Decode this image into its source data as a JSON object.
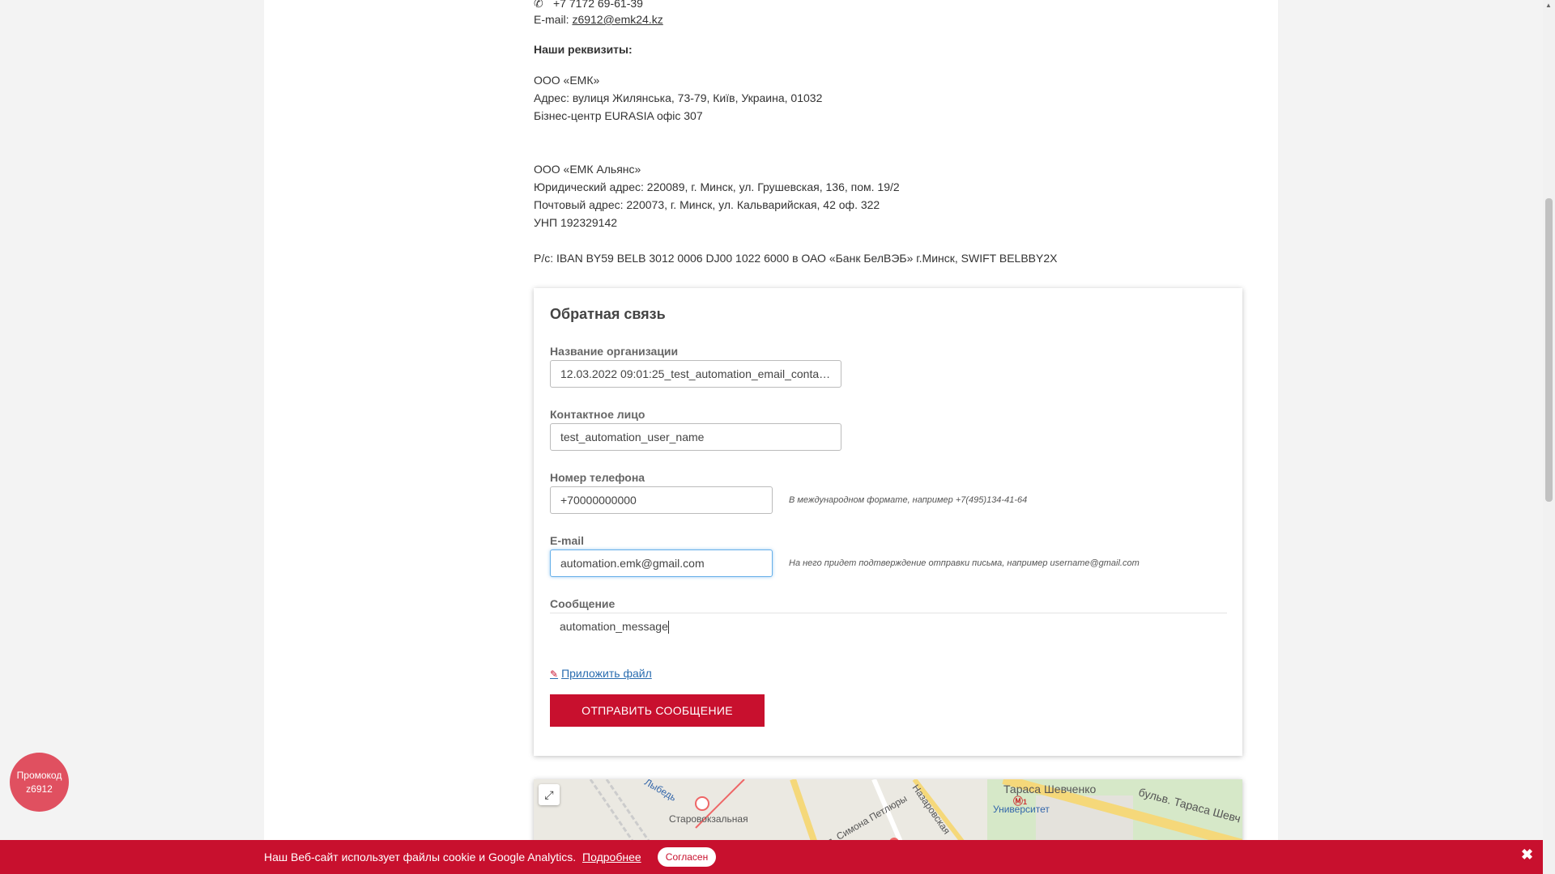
{
  "contacts": {
    "phone": "+7 7172 69-61-39",
    "email_label": "E-mail:",
    "email": "z6912@emk24.kz"
  },
  "requisites": {
    "heading": "Наши реквизиты:",
    "company1_name": "ООО «ЕМК»",
    "company1_address": "Адрес: вулиця Жилянська, 73-79, Київ, Украина, 01032",
    "company1_office": "Бізнес-центр EURASIA офіс 307",
    "company2_name": "ООО «ЕМК Альянс»",
    "company2_legal": "Юридический адрес: 220089, г. Минск, ул. Грушевская, 136, пом. 19/2",
    "company2_post": "Почтовый адрес: 220073, г. Минск, ул. Кальварийская, 42 оф. 322",
    "company2_unp": "УНП 192329142",
    "company2_bank": "Р/с: IBAN BY59 BELB 3012 0006 DJ00 1022 6000 в ОАО «Банк БелВЭБ» г.Минск, SWIFT BELBBY2X"
  },
  "form": {
    "title": "Обратная связь",
    "org_label": "Название организации",
    "org_value": "12.03.2022 09:01:25_test_automation_email_conta…",
    "contact_label": "Контактное лицо",
    "contact_value": "test_automation_user_name",
    "phone_label": "Номер телефона",
    "phone_value": "+70000000000",
    "phone_hint": "В международном формате, например +7(495)134-41-64",
    "email_label": "E-mail",
    "email_value": "automation.emk@gmail.com",
    "email_hint": "На него придет подтверждение отправки письма, например username@gmail.com",
    "message_label": "Сообщение",
    "message_value": "automation_message",
    "attach_label": "Приложить файл",
    "submit_label": "ОТПРАВИТЬ СООБЩЕНИЕ"
  },
  "map": {
    "station": "Старовокзальная",
    "street1": "ул. Симона Петлюры",
    "street2": "Назаровская",
    "street3": "Тараса Шевченко",
    "street4": "бульв. Тараса Шевч",
    "metro": "Университет",
    "metro_line": "1",
    "street5": "Лыбедь"
  },
  "promo": {
    "line1": "Промокод",
    "line2": "z6912"
  },
  "cookie": {
    "text": "Наш Веб-сайт использует файлы cookie и Google Analytics.",
    "link": "Подробнее",
    "accept": "Согласен",
    "close": "✖"
  }
}
